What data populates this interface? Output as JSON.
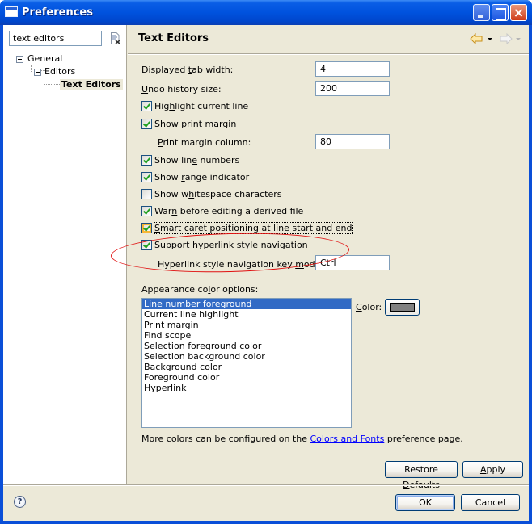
{
  "window": {
    "title": "Preferences",
    "controls": {
      "minimize": "minimize",
      "maximize": "maximize",
      "close": "×"
    }
  },
  "sidebar": {
    "filter_value": "text editors",
    "clear_icon": "clear-filter-icon",
    "tree": [
      {
        "label": "General",
        "expanded": true,
        "level": 0
      },
      {
        "label": "Editors",
        "expanded": true,
        "level": 1
      },
      {
        "label": "Text Editors",
        "selected": true,
        "level": 2
      }
    ]
  },
  "page": {
    "title": "Text Editors",
    "nav": {
      "back": "back-arrow-icon",
      "forward": "forward-arrow-icon"
    },
    "fields": [
      {
        "label": "Displayed tab width:",
        "mnemonic": "t",
        "value": "4"
      },
      {
        "label": "Undo history size:",
        "mnemonic": "U",
        "value": "200"
      },
      {
        "label": "Print margin column:",
        "mnemonic": "P",
        "value": "80"
      },
      {
        "label": "Hyperlink style navigation key modifier:",
        "mnemonic": "m",
        "value": "Ctrl"
      }
    ],
    "checkboxes": [
      {
        "label": "Highlight current line",
        "checked": true
      },
      {
        "label": "Show print margin",
        "checked": true
      },
      {
        "label": "Show line numbers",
        "checked": true
      },
      {
        "label": "Show range indicator",
        "checked": true
      },
      {
        "label": "Show whitespace characters",
        "checked": false
      },
      {
        "label": "Warn before editing a derived file",
        "checked": true
      },
      {
        "label": "Smart caret positioning at line start and end",
        "checked": true,
        "focused": true
      },
      {
        "label": "Support hyperlink style navigation",
        "checked": true
      }
    ],
    "appearance": {
      "label": "Appearance color options:",
      "items": [
        "Line number foreground",
        "Current line highlight",
        "Print margin",
        "Find scope",
        "Selection foreground color",
        "Selection background color",
        "Background color",
        "Foreground color",
        "Hyperlink"
      ],
      "selected_index": 0,
      "color_label": "Color:",
      "color_value": "#808080"
    },
    "info": {
      "before": "More colors can be configured on the ",
      "link": "Colors and Fonts",
      "after": " preference page."
    },
    "restore_defaults_label": "Restore Defaults",
    "apply_label": "Apply"
  },
  "footer": {
    "help_icon": "?",
    "ok_label": "OK",
    "cancel_label": "Cancel"
  },
  "annotation": {
    "color": "#e01010",
    "shape": "ellipse"
  },
  "colors": {
    "titlebar": "#0052de",
    "dialog_bg": "#ece9d8",
    "selection": "#316ac5",
    "link": "#0000ff"
  }
}
